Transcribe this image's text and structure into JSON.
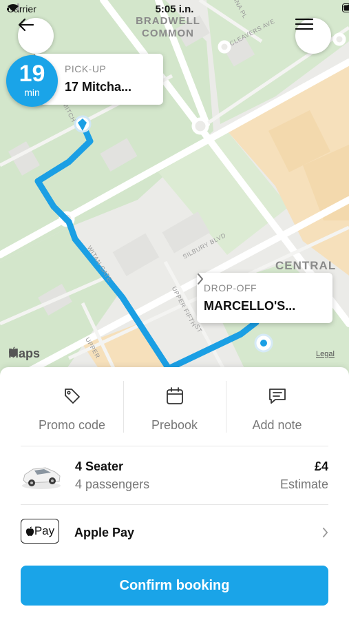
{
  "status_bar": {
    "carrier": "Carrier",
    "time": "5:05 i.n."
  },
  "map": {
    "area_labels": {
      "bradwell_line1": "BRADWELL",
      "bradwell_line2": "COMMON",
      "central": "CENTRAL"
    },
    "street_labels": {
      "silbury": "SILBURY BLVD",
      "upper_fifth_1": "UPPER FIFTH",
      "upper_fifth_2": "ST",
      "witan": "WITAN GATE",
      "cleavers": "CLEAVERS AVE",
      "lina": "LINA PL",
      "mitch": "MITCH",
      "upper": "UPPER"
    },
    "attribution": "Maps",
    "legal": "Legal"
  },
  "eta": {
    "value": "19",
    "unit": "min"
  },
  "pickup": {
    "caption": "PICK-UP",
    "address": "17 Mitcha..."
  },
  "dropoff": {
    "caption": "DROP-OFF",
    "address": "MARCELLO'S..."
  },
  "actions": [
    {
      "label": "Promo code",
      "icon": "tag-icon"
    },
    {
      "label": "Prebook",
      "icon": "calendar-icon"
    },
    {
      "label": "Add note",
      "icon": "note-icon"
    }
  ],
  "vehicle": {
    "name": "4 Seater",
    "passengers": "4 passengers",
    "price": "£4",
    "price_note": "Estimate"
  },
  "payment": {
    "badge": "Pay",
    "method": "Apple Pay"
  },
  "confirm_label": "Confirm booking",
  "colors": {
    "accent": "#1aa4e8",
    "park": "#cfe3c6",
    "commercial": "#f6dfb8"
  }
}
